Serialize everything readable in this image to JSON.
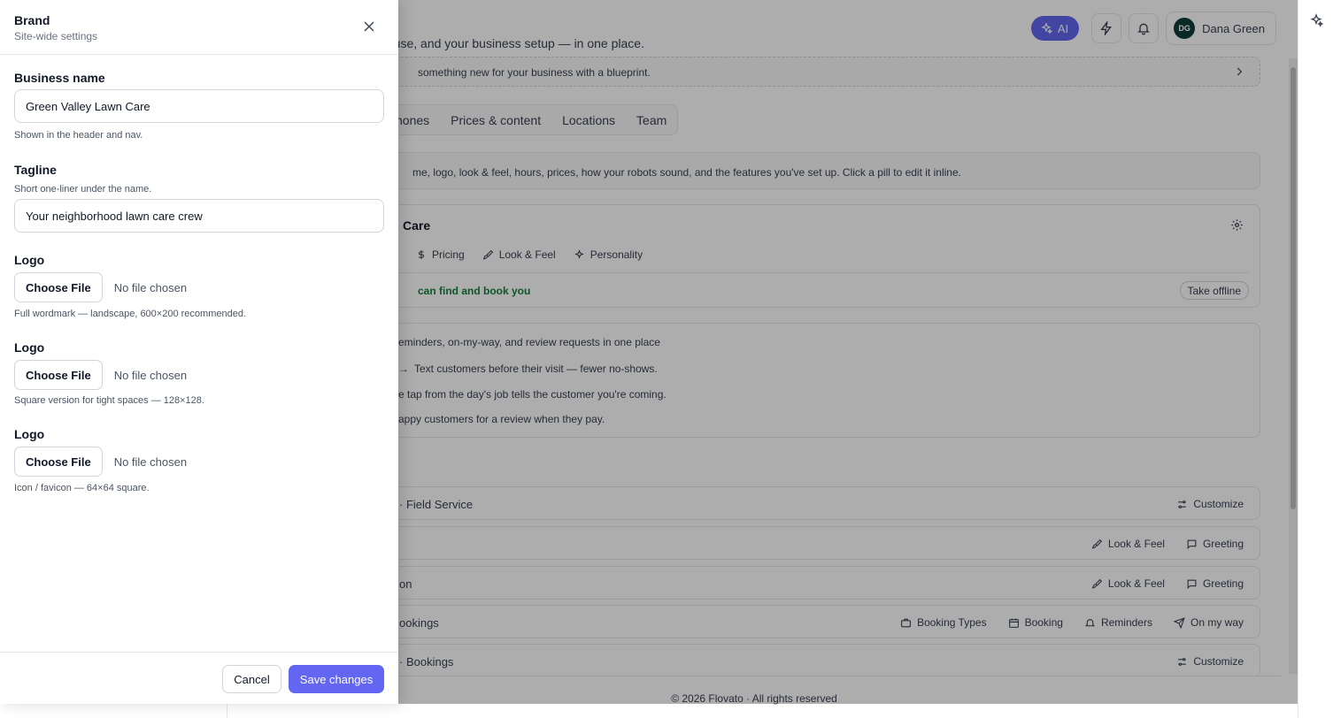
{
  "background": {
    "top_bar": {
      "ai_label": "AI",
      "user_initials": "DG",
      "user_name": "Dana Green"
    },
    "subtitle": "ey use, and your business setup — in one place.",
    "blueprint_text": "something new for your business with a blueprint.",
    "tabs": [
      "hones",
      "Prices & content",
      "Locations",
      "Team"
    ],
    "info_text": "me, logo, look & feel, hours, prices, how your robots sound, and the features you've set up. Click a pill to edit it inline.",
    "brand_card": {
      "title": "Care",
      "pills": [
        "Pricing",
        "Look & Feel",
        "Personality"
      ],
      "status": "can find and book you",
      "offline_button": "Take offline"
    },
    "features": [
      "eminders, on-my-way, and review requests in one place",
      "Text customers before their visit — fewer no-shows.",
      "e tap from the day's job tells the customer you're coming.",
      "appy customers for a review when they pay."
    ],
    "rows": [
      {
        "label": "· Field Service",
        "actions": [
          "Customize"
        ]
      },
      {
        "label": "",
        "actions": [
          "Look & Feel",
          "Greeting"
        ]
      },
      {
        "label": "on",
        "actions": [
          "Look & Feel",
          "Greeting"
        ]
      },
      {
        "label": "ookings",
        "actions": [
          "Booking Types",
          "Booking",
          "Reminders",
          "On my way"
        ]
      },
      {
        "label": "· Bookings",
        "actions": [
          "Customize"
        ]
      }
    ],
    "footer": "© 2026 Flovato · All rights reserved"
  },
  "drawer": {
    "title": "Brand",
    "subtitle": "Site-wide settings",
    "business_name": {
      "label": "Business name",
      "value": "Green Valley Lawn Care",
      "help": "Shown in the header and nav."
    },
    "tagline": {
      "label": "Tagline",
      "help": "Short one-liner under the name.",
      "value": "Your neighborhood lawn care crew"
    },
    "logos": [
      {
        "label": "Logo",
        "button": "Choose File",
        "status": "No file chosen",
        "help": "Full wordmark — landscape, 600×200 recommended."
      },
      {
        "label": "Logo",
        "button": "Choose File",
        "status": "No file chosen",
        "help": "Square version for tight spaces — 128×128."
      },
      {
        "label": "Logo",
        "button": "Choose File",
        "status": "No file chosen",
        "help": "Icon / favicon — 64×64 square."
      }
    ],
    "cancel_label": "Cancel",
    "save_label": "Save changes"
  },
  "colors": {
    "accent": "#6366f1",
    "success": "#15803d",
    "avatar_bg": "#0f3d35"
  }
}
